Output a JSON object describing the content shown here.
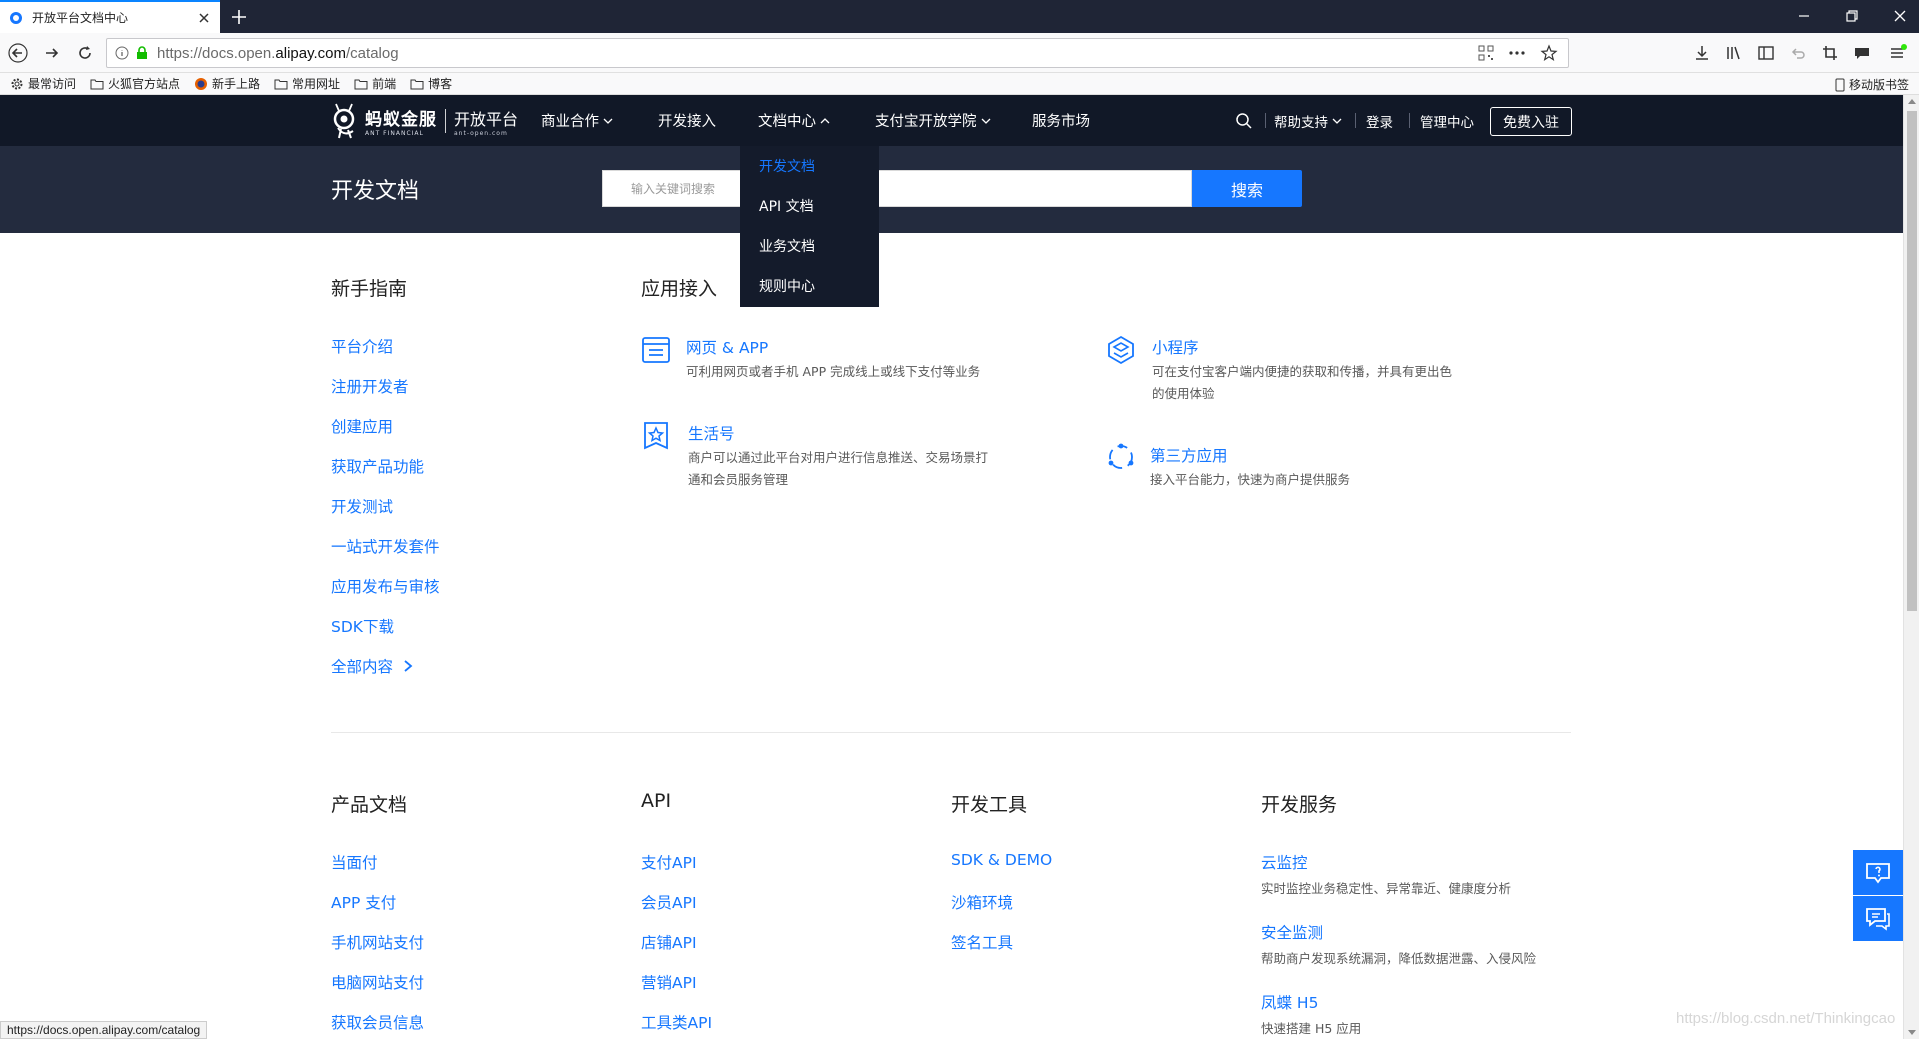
{
  "browser": {
    "tab_title": "开放平台文档中心",
    "url_prefix": "https://docs.open.",
    "url_domain": "alipay.com",
    "url_path": "/catalog",
    "bookmarks": [
      "最常访问",
      "火狐官方站点",
      "新手上路",
      "常用网址",
      "前端",
      "博客"
    ],
    "mobile_bookmarks": "移动版书签",
    "status_url": "https://docs.open.alipay.com/catalog"
  },
  "header": {
    "brand": "蚂蚁金服",
    "brand_en": "ANT FINANCIAL",
    "platform": "开放平台",
    "platform_en": "ant-open.com",
    "nav": [
      "商业合作",
      "开发接入",
      "文档中心",
      "支付宝开放学院",
      "服务市场"
    ],
    "help": "帮助支持",
    "login": "登录",
    "admin": "管理中心",
    "join": "免费入驻"
  },
  "banner": {
    "title": "开发文档",
    "search_placeholder": "输入关键词搜索",
    "search_button": "搜索"
  },
  "dropdown": {
    "items": [
      "开发文档",
      "API 文档",
      "业务文档",
      "规则中心"
    ],
    "active_color": "#1677ff"
  },
  "guide": {
    "title": "新手指南",
    "links": [
      "平台介绍",
      "注册开发者",
      "创建应用",
      "获取产品功能",
      "开发测试",
      "一站式开发套件",
      "应用发布与审核",
      "SDK下载",
      "全部内容"
    ]
  },
  "access": {
    "title": "应用接入",
    "cards": [
      {
        "title": "网页 & APP",
        "desc": "可利用网页或者手机 APP 完成线上或线下支付等业务",
        "icon": "web-app-icon"
      },
      {
        "title": "小程序",
        "desc": "可在支付宝客户端内便捷的获取和传播，并具有更出色",
        "desc2": "的使用体验",
        "icon": "mini-program-icon"
      },
      {
        "title": "生活号",
        "desc": "商户可以通过此平台对用户进行信息推送、交易场景打",
        "desc2": "通和会员服务管理",
        "icon": "star-badge-icon"
      },
      {
        "title": "第三方应用",
        "desc": "接入平台能力，快速为商户提供服务",
        "icon": "third-party-icon"
      }
    ]
  },
  "bottom": {
    "product": {
      "title": "产品文档",
      "links": [
        "当面付",
        "APP 支付",
        "手机网站支付",
        "电脑网站支付",
        "获取会员信息"
      ]
    },
    "api": {
      "title": "API",
      "links": [
        "支付API",
        "会员API",
        "店铺API",
        "营销API",
        "工具类API"
      ]
    },
    "tools": {
      "title": "开发工具",
      "links": [
        "SDK & DEMO",
        "沙箱环境",
        "签名工具"
      ]
    },
    "services": {
      "title": "开发服务",
      "items": [
        {
          "name": "云监控",
          "desc": "实时监控业务稳定性、异常靠近、健康度分析"
        },
        {
          "name": "安全监测",
          "desc": "帮助商户发现系统漏洞，降低数据泄露、入侵风险"
        },
        {
          "name": "凤蝶 H5",
          "desc": "快速搭建 H5 应用"
        }
      ]
    }
  },
  "watermark": "https://blog.csdn.net/Thinkingcao",
  "colors": {
    "accent": "#1677ff",
    "header_bg": "#111827",
    "banner_bg": "#232b3e"
  }
}
